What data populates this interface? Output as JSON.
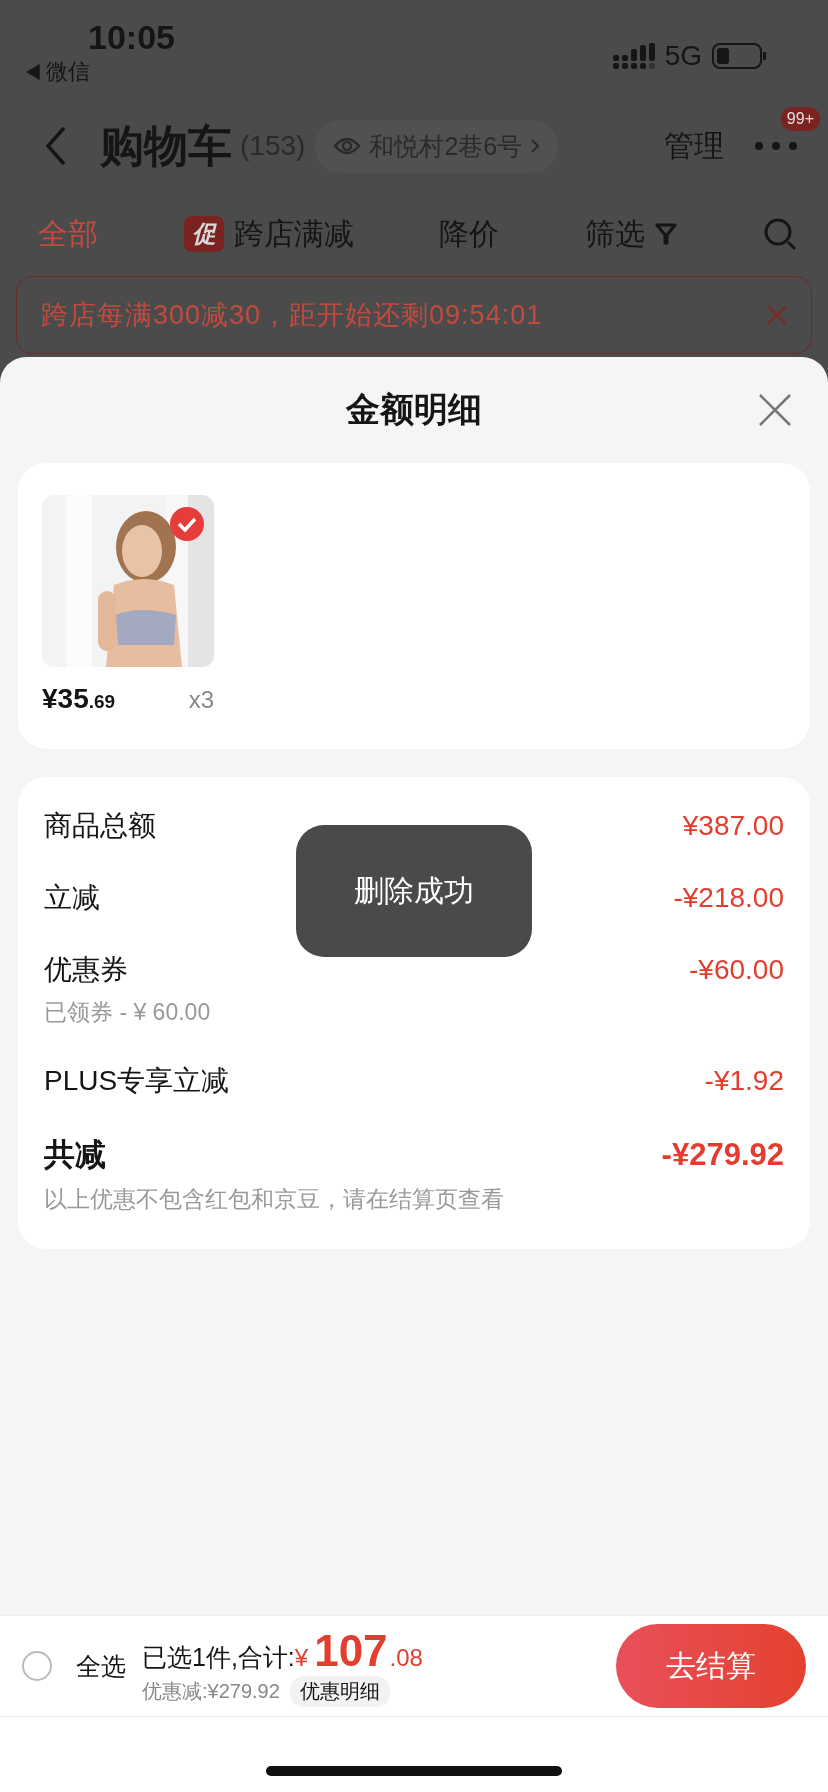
{
  "status_bar": {
    "time": "10:05",
    "back_app": "微信",
    "network": "5G"
  },
  "nav": {
    "title": "购物车",
    "count": "(153)",
    "address": "和悦村2巷6号",
    "manage": "管理",
    "badge": "99+"
  },
  "tabs": [
    {
      "label": "全部",
      "kind": "plain",
      "selected": true
    },
    {
      "label": "跨店满减",
      "kind": "promo",
      "tag": "促",
      "selected": false
    },
    {
      "label": "降价",
      "kind": "plain",
      "selected": false
    },
    {
      "label": "筛选",
      "kind": "filter",
      "selected": false
    }
  ],
  "banner": {
    "text": "跨店每满300减30，距开始还剩09:54:01"
  },
  "sheet": {
    "title": "金额明细"
  },
  "items": [
    {
      "kind": "picture",
      "price_main": "¥35",
      "price_cents": ".69",
      "quantity": "x3",
      "checked": true
    }
  ],
  "summary": [
    {
      "label": "商品总额",
      "value": "¥387.00",
      "kind": "normal"
    },
    {
      "label": "立减",
      "value": "-¥218.00",
      "kind": "normal"
    },
    {
      "label": "优惠券",
      "value": "-¥60.00",
      "note": "已领券 - ¥ 60.00",
      "kind": "normal"
    },
    {
      "label": "PLUS专享立减",
      "value": "-¥1.92",
      "kind": "normal"
    },
    {
      "label": "共减",
      "value": "-¥279.92",
      "note": "以上优惠不包含红包和京豆，请在结算页查看",
      "kind": "total"
    }
  ],
  "toast": "删除成功",
  "bottom_bar": {
    "select_all": "全选",
    "checked": false,
    "selected_text": "已选1件,合计:",
    "currency": "¥",
    "total_main": "107",
    "total_cents": ".08",
    "discount": "优惠减:¥279.92",
    "detail_button": "优惠明细",
    "checkout": "去结算"
  }
}
